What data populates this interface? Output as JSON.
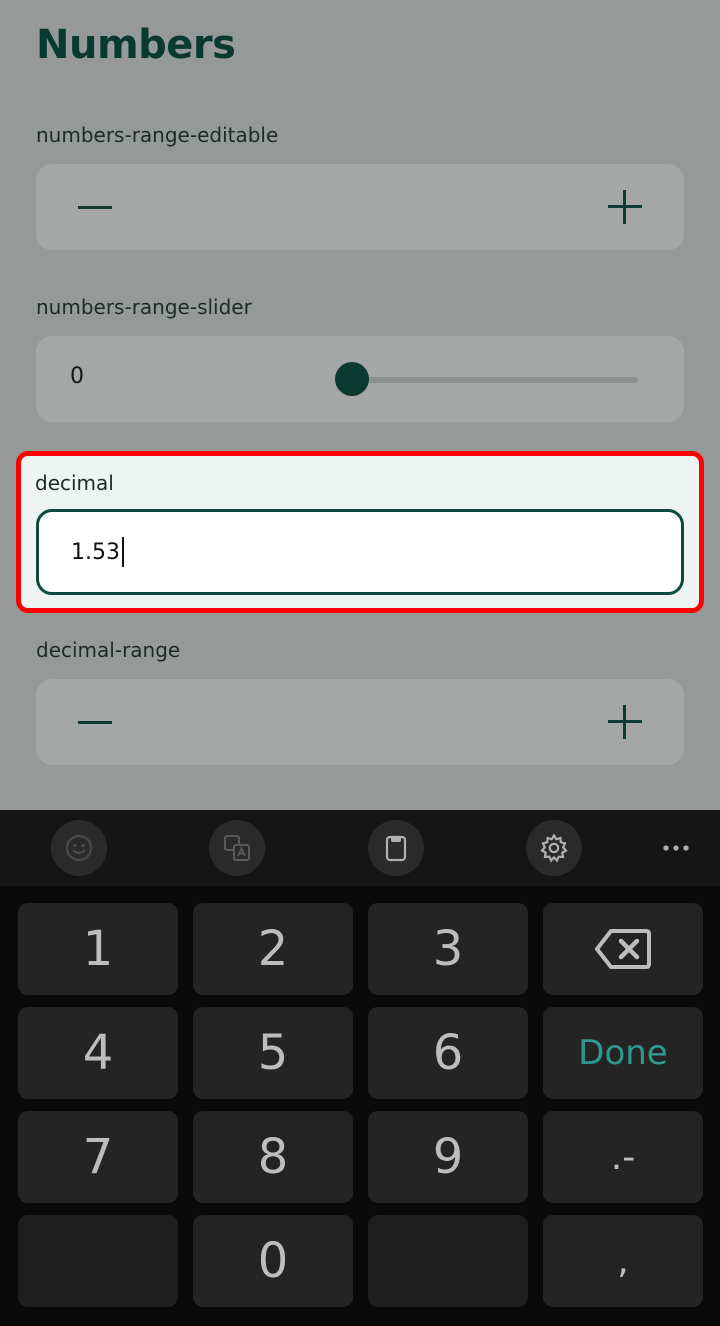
{
  "page": {
    "title": "Numbers"
  },
  "fields": {
    "range_editable": {
      "label": "numbers-range-editable"
    },
    "range_slider": {
      "label": "numbers-range-slider",
      "value": "0",
      "slider_fraction": 0
    },
    "decimal": {
      "label": "decimal",
      "value": "1.53"
    },
    "decimal_range": {
      "label": "decimal-range"
    }
  },
  "keyboard": {
    "toolbar": [
      "smiley-icon",
      "translate-icon",
      "clipboard-icon",
      "gear-icon",
      "more-icon"
    ],
    "keys": {
      "k1": "1",
      "k2": "2",
      "k3": "3",
      "k4": "4",
      "k5": "5",
      "k6": "6",
      "k7": "7",
      "k8": "8",
      "k9": "9",
      "k0": "0",
      "done": "Done",
      "dot_minus": ".-",
      "comma": ","
    }
  },
  "colors": {
    "accent": "#0b3a31",
    "done_key": "#2e9a8d",
    "highlight_border": "#ff0000"
  }
}
